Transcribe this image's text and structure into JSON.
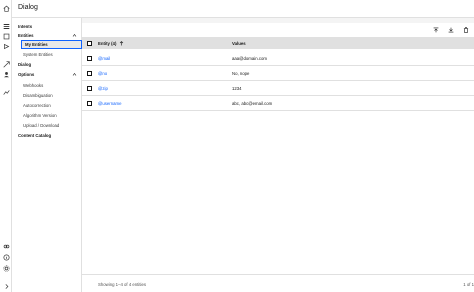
{
  "topbar": {
    "title": "Dialog"
  },
  "leftnav": {
    "intents": "Intents",
    "entities": "Entities",
    "my_entities": "My Entities",
    "system_entities": "System Entities",
    "dialog": "Dialog",
    "options": "Options",
    "option_items": [
      "Webhooks",
      "Disambiguation",
      "Autocorrection",
      "Algorithm Version",
      "Upload / Download"
    ],
    "content_catalog": "Content Catalog"
  },
  "table": {
    "entity_header": "Entity (4)",
    "values_header": "Values",
    "rows": [
      {
        "entity": "@mail",
        "value": "aaa@domain.com"
      },
      {
        "entity": "@no",
        "value": "No, nope"
      },
      {
        "entity": "@zip",
        "value": "1234"
      },
      {
        "entity": "@username",
        "value": "abc, abc@email.com"
      }
    ],
    "showing": "Showing 1–4 of 4 entities",
    "pages": "1 of 1"
  },
  "accent_color": "#0f62fe"
}
